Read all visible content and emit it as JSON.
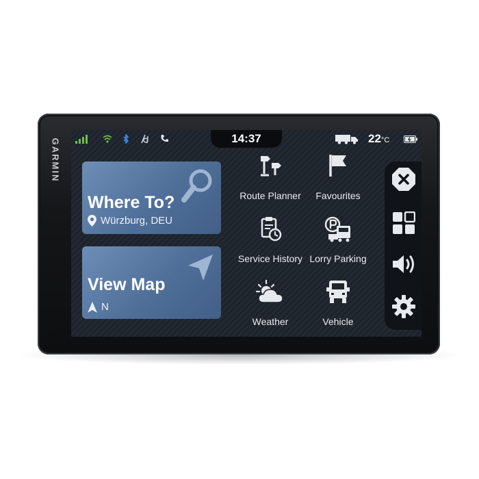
{
  "device": {
    "brand": "GARMIN"
  },
  "status_bar": {
    "time": "14:37",
    "temperature": "22",
    "temperature_unit": "°C",
    "icons": [
      "signal-icon",
      "wifi-icon",
      "bluetooth-icon",
      "driver-assist-icon",
      "phone-icon",
      "truck-icon",
      "battery-icon"
    ]
  },
  "cards": {
    "where_to": {
      "title": "Where To?",
      "location": "Würzburg, DEU",
      "icon": "search-icon"
    },
    "view_map": {
      "title": "View Map",
      "heading": "N",
      "icon": "navigation-arrow-icon"
    }
  },
  "apps": [
    {
      "label": "Route Planner",
      "icon": "route-planner-icon"
    },
    {
      "label": "Favourites",
      "icon": "flag-icon"
    },
    {
      "label": "Service History",
      "icon": "service-history-icon"
    },
    {
      "label": "Lorry Parking",
      "icon": "lorry-parking-icon"
    },
    {
      "label": "Weather",
      "icon": "weather-icon"
    },
    {
      "label": "Vehicle",
      "icon": "vehicle-icon"
    }
  ],
  "side_rail": [
    "stop-icon",
    "apps-grid-icon",
    "volume-icon",
    "settings-gear-icon"
  ],
  "colors": {
    "card_blue": "#5a7aa4",
    "signal_green": "#6cc04a",
    "wifi_green": "#6cc04a",
    "bluetooth_blue": "#3d8ee8"
  }
}
